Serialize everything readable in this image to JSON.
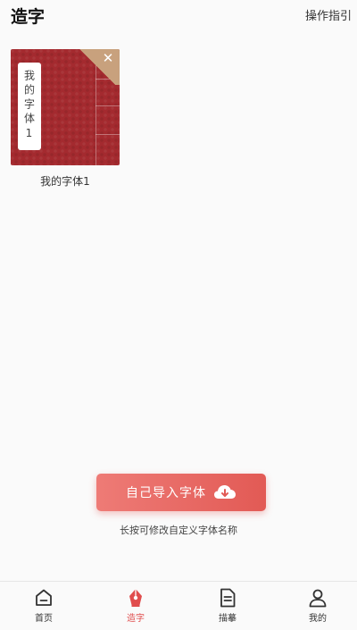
{
  "header": {
    "title": "造字",
    "guide_label": "操作指引"
  },
  "fonts": [
    {
      "cover_label": "我的字体1",
      "name": "我的字体1"
    }
  ],
  "import": {
    "button_label": "自己导入字体",
    "hint": "长按可修改自定义字体名称"
  },
  "nav": {
    "items": [
      {
        "label": "首页",
        "icon": "home-icon"
      },
      {
        "label": "造字",
        "icon": "pen-nib-icon",
        "active": true
      },
      {
        "label": "描摹",
        "icon": "document-icon"
      },
      {
        "label": "我的",
        "icon": "user-icon"
      }
    ]
  },
  "colors": {
    "accent": "#e25a55",
    "book_cover": "#a42a2f",
    "corner": "#c8a17d"
  }
}
